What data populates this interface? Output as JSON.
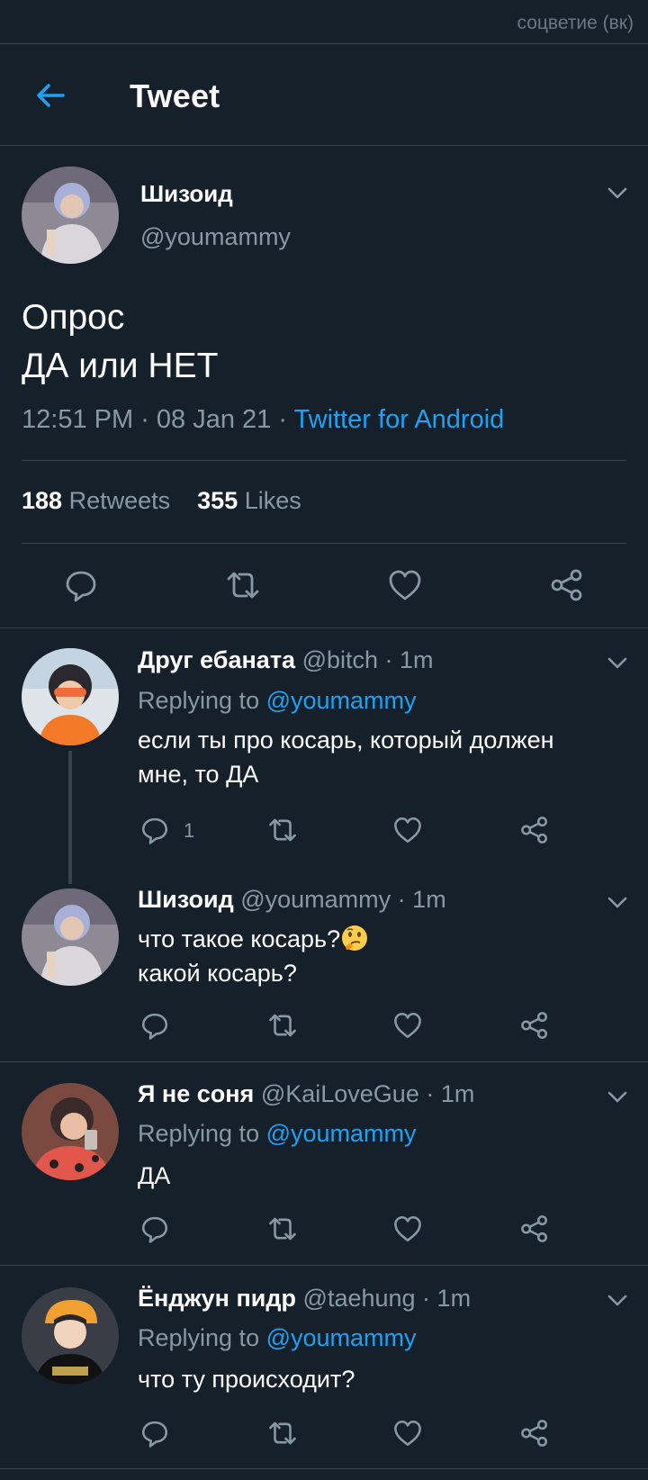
{
  "watermark": "соцветие (вк)",
  "header": {
    "title": "Tweet"
  },
  "main_tweet": {
    "name": "Шизоид",
    "handle": "@youmammy",
    "text_line1": "Опрос",
    "text_line2": "ДА или НЕТ",
    "time": "12:51 PM",
    "date": "08 Jan 21",
    "source": "Twitter for Android",
    "retweets": "188",
    "retweets_label": "Retweets",
    "likes": "355",
    "likes_label": "Likes"
  },
  "replies": [
    {
      "name": "Друг ебаната",
      "handle": "@bitch",
      "time": "1m",
      "replying_prefix": "Replying to ",
      "replying_to": "@youmammy",
      "text_line1": "если ты про косарь, который должен",
      "text_line2": "мне, то ДА",
      "reply_count": "1"
    },
    {
      "name": "Шизоид",
      "handle": "@youmammy",
      "time": "1m",
      "text_line1": "что такое косарь?",
      "text_line2": "какой косарь?",
      "emoji": "thinking-face-emoji"
    },
    {
      "name": "Я не соня",
      "handle": "@KaiLoveGue",
      "time": "1m",
      "replying_prefix": "Replying to ",
      "replying_to": "@youmammy",
      "text_line1": "ДА"
    },
    {
      "name": "Ёнджун пидр",
      "handle": "@taehung",
      "time": "1m",
      "replying_prefix": "Replying to ",
      "replying_to": "@youmammy",
      "text_line1": "что ту происходит?"
    }
  ],
  "separator": " · ",
  "colors": {
    "background": "#15202b",
    "accent": "#1da1f2",
    "secondary_text": "#8899a6",
    "divider": "#38444d"
  },
  "icons": {
    "back": "arrow-left-icon",
    "caret": "chevron-down-icon",
    "reply": "speech-bubble-icon",
    "retweet": "retweet-icon",
    "like": "heart-icon",
    "share": "share-icon"
  }
}
